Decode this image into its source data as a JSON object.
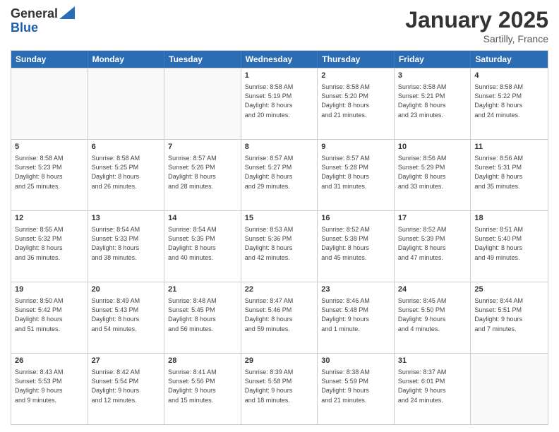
{
  "header": {
    "logo_line1": "General",
    "logo_line2": "Blue",
    "month": "January 2025",
    "location": "Sartilly, France"
  },
  "days_of_week": [
    "Sunday",
    "Monday",
    "Tuesday",
    "Wednesday",
    "Thursday",
    "Friday",
    "Saturday"
  ],
  "weeks": [
    [
      {
        "day": "",
        "info": ""
      },
      {
        "day": "",
        "info": ""
      },
      {
        "day": "",
        "info": ""
      },
      {
        "day": "1",
        "info": "Sunrise: 8:58 AM\nSunset: 5:19 PM\nDaylight: 8 hours\nand 20 minutes."
      },
      {
        "day": "2",
        "info": "Sunrise: 8:58 AM\nSunset: 5:20 PM\nDaylight: 8 hours\nand 21 minutes."
      },
      {
        "day": "3",
        "info": "Sunrise: 8:58 AM\nSunset: 5:21 PM\nDaylight: 8 hours\nand 23 minutes."
      },
      {
        "day": "4",
        "info": "Sunrise: 8:58 AM\nSunset: 5:22 PM\nDaylight: 8 hours\nand 24 minutes."
      }
    ],
    [
      {
        "day": "5",
        "info": "Sunrise: 8:58 AM\nSunset: 5:23 PM\nDaylight: 8 hours\nand 25 minutes."
      },
      {
        "day": "6",
        "info": "Sunrise: 8:58 AM\nSunset: 5:25 PM\nDaylight: 8 hours\nand 26 minutes."
      },
      {
        "day": "7",
        "info": "Sunrise: 8:57 AM\nSunset: 5:26 PM\nDaylight: 8 hours\nand 28 minutes."
      },
      {
        "day": "8",
        "info": "Sunrise: 8:57 AM\nSunset: 5:27 PM\nDaylight: 8 hours\nand 29 minutes."
      },
      {
        "day": "9",
        "info": "Sunrise: 8:57 AM\nSunset: 5:28 PM\nDaylight: 8 hours\nand 31 minutes."
      },
      {
        "day": "10",
        "info": "Sunrise: 8:56 AM\nSunset: 5:29 PM\nDaylight: 8 hours\nand 33 minutes."
      },
      {
        "day": "11",
        "info": "Sunrise: 8:56 AM\nSunset: 5:31 PM\nDaylight: 8 hours\nand 35 minutes."
      }
    ],
    [
      {
        "day": "12",
        "info": "Sunrise: 8:55 AM\nSunset: 5:32 PM\nDaylight: 8 hours\nand 36 minutes."
      },
      {
        "day": "13",
        "info": "Sunrise: 8:54 AM\nSunset: 5:33 PM\nDaylight: 8 hours\nand 38 minutes."
      },
      {
        "day": "14",
        "info": "Sunrise: 8:54 AM\nSunset: 5:35 PM\nDaylight: 8 hours\nand 40 minutes."
      },
      {
        "day": "15",
        "info": "Sunrise: 8:53 AM\nSunset: 5:36 PM\nDaylight: 8 hours\nand 42 minutes."
      },
      {
        "day": "16",
        "info": "Sunrise: 8:52 AM\nSunset: 5:38 PM\nDaylight: 8 hours\nand 45 minutes."
      },
      {
        "day": "17",
        "info": "Sunrise: 8:52 AM\nSunset: 5:39 PM\nDaylight: 8 hours\nand 47 minutes."
      },
      {
        "day": "18",
        "info": "Sunrise: 8:51 AM\nSunset: 5:40 PM\nDaylight: 8 hours\nand 49 minutes."
      }
    ],
    [
      {
        "day": "19",
        "info": "Sunrise: 8:50 AM\nSunset: 5:42 PM\nDaylight: 8 hours\nand 51 minutes."
      },
      {
        "day": "20",
        "info": "Sunrise: 8:49 AM\nSunset: 5:43 PM\nDaylight: 8 hours\nand 54 minutes."
      },
      {
        "day": "21",
        "info": "Sunrise: 8:48 AM\nSunset: 5:45 PM\nDaylight: 8 hours\nand 56 minutes."
      },
      {
        "day": "22",
        "info": "Sunrise: 8:47 AM\nSunset: 5:46 PM\nDaylight: 8 hours\nand 59 minutes."
      },
      {
        "day": "23",
        "info": "Sunrise: 8:46 AM\nSunset: 5:48 PM\nDaylight: 9 hours\nand 1 minute."
      },
      {
        "day": "24",
        "info": "Sunrise: 8:45 AM\nSunset: 5:50 PM\nDaylight: 9 hours\nand 4 minutes."
      },
      {
        "day": "25",
        "info": "Sunrise: 8:44 AM\nSunset: 5:51 PM\nDaylight: 9 hours\nand 7 minutes."
      }
    ],
    [
      {
        "day": "26",
        "info": "Sunrise: 8:43 AM\nSunset: 5:53 PM\nDaylight: 9 hours\nand 9 minutes."
      },
      {
        "day": "27",
        "info": "Sunrise: 8:42 AM\nSunset: 5:54 PM\nDaylight: 9 hours\nand 12 minutes."
      },
      {
        "day": "28",
        "info": "Sunrise: 8:41 AM\nSunset: 5:56 PM\nDaylight: 9 hours\nand 15 minutes."
      },
      {
        "day": "29",
        "info": "Sunrise: 8:39 AM\nSunset: 5:58 PM\nDaylight: 9 hours\nand 18 minutes."
      },
      {
        "day": "30",
        "info": "Sunrise: 8:38 AM\nSunset: 5:59 PM\nDaylight: 9 hours\nand 21 minutes."
      },
      {
        "day": "31",
        "info": "Sunrise: 8:37 AM\nSunset: 6:01 PM\nDaylight: 9 hours\nand 24 minutes."
      },
      {
        "day": "",
        "info": ""
      }
    ]
  ]
}
